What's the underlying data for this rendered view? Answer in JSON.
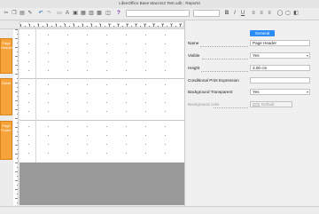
{
  "window": {
    "title": "LibreOffice Base Macros2 Test.odb : Report4"
  },
  "toolbar": {
    "icons": [
      "cut-icon",
      "copy-icon",
      "paste-icon",
      "format-paint-icon",
      "undo-icon",
      "redo-icon",
      "control-icon",
      "label-icon",
      "field-icon",
      "image-icon",
      "help-icon",
      "bold-icon",
      "italic-icon",
      "underline-icon",
      "align-left-icon",
      "align-center-icon",
      "align-right-icon"
    ]
  },
  "sections": {
    "page_header": "Page Header",
    "detail": "Detail",
    "page_footer": "Page Footer"
  },
  "ruler": {
    "labels": [
      "1",
      "2",
      "3",
      "4",
      "5",
      "6",
      "7",
      "8",
      "9",
      "10",
      "11",
      "12",
      "13",
      "14",
      "15",
      "16",
      "17",
      "18"
    ]
  },
  "properties": {
    "tab": "General",
    "name_label": "Name",
    "name_value": "Page Header",
    "visible_label": "Visible",
    "visible_value": "Yes",
    "height_label": "Height",
    "height_value": "3.00 cm",
    "conditional_label": "Conditional Print Expression",
    "conditional_value": "",
    "bg_transparent_label": "Background Transparent",
    "bg_transparent_value": "Yes",
    "bg_color_label": "Background color",
    "bg_color_value": "Default"
  }
}
